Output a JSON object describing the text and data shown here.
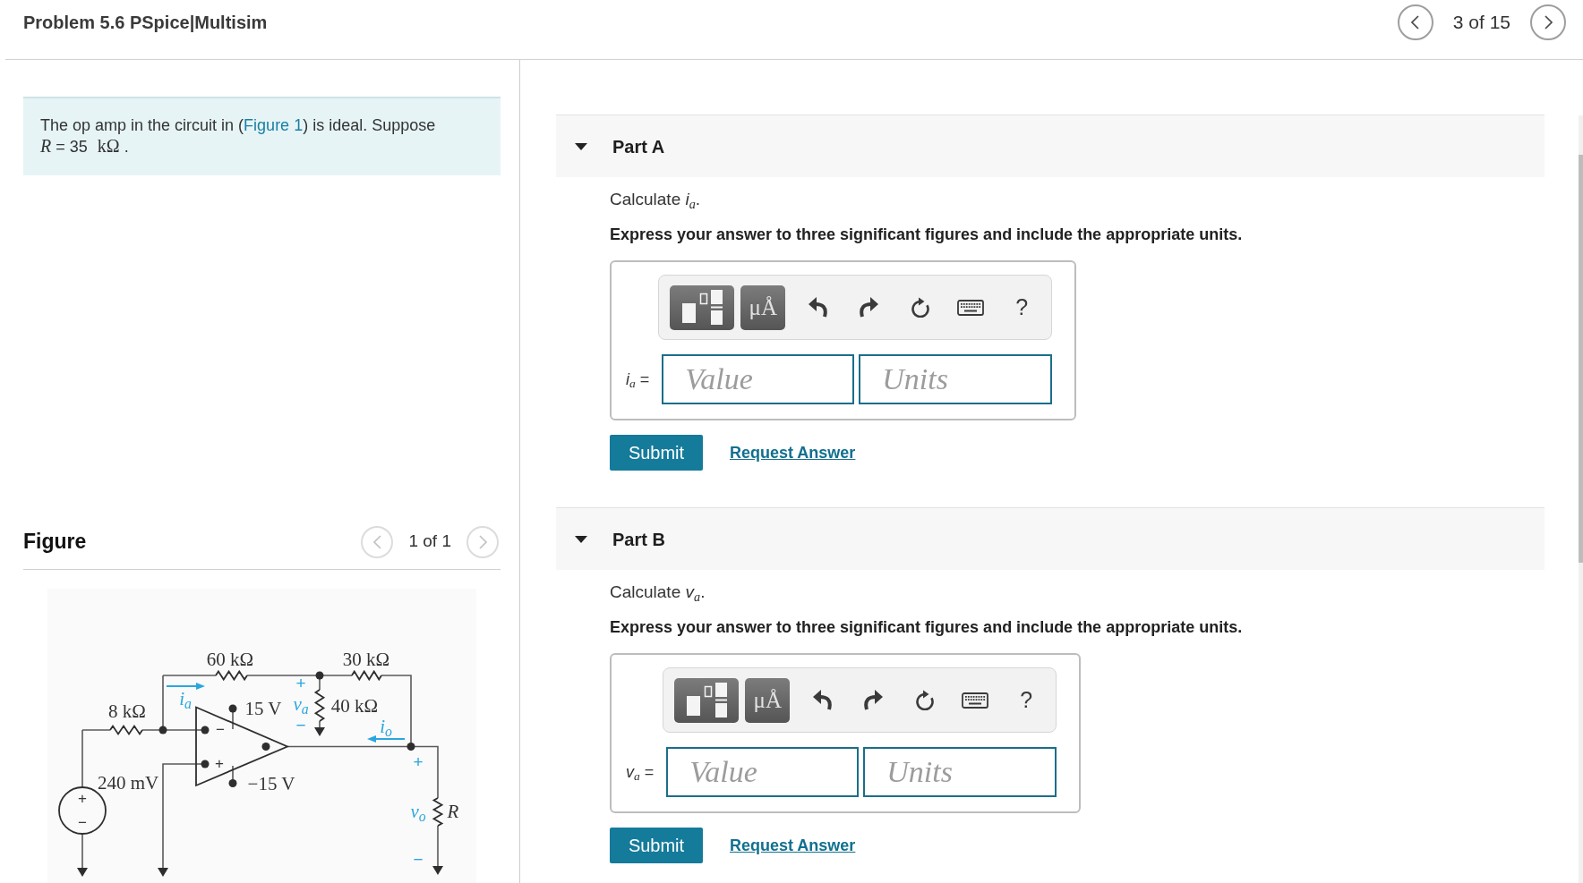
{
  "header": {
    "title": "Problem 5.6 PSpice|Multisim",
    "pager": {
      "position": "3 of 15",
      "prev": {
        "disabled": false
      },
      "next": {
        "disabled": false
      }
    }
  },
  "problem": {
    "text_before": "The op amp in the circuit in (",
    "link": "Figure 1",
    "text_after": ") is ideal. Suppose",
    "equation": {
      "variable": "R",
      "value": "= 35",
      "unit": "kΩ",
      "end": "."
    }
  },
  "figure": {
    "title": "Figure",
    "pager": {
      "position": "1 of 1",
      "prev": {
        "disabled": true
      },
      "next": {
        "disabled": true
      }
    },
    "labels": [
      {
        "kind": "value",
        "text": "60 kΩ"
      },
      {
        "kind": "value",
        "text": "30 kΩ"
      },
      {
        "kind": "sign",
        "text": "+"
      },
      {
        "kind": "quantity",
        "text": "i$_{a}$"
      },
      {
        "kind": "value",
        "text": "15 V"
      },
      {
        "kind": "quantity",
        "text": "v$_{a}$"
      },
      {
        "kind": "value",
        "text": "40 kΩ"
      },
      {
        "kind": "value",
        "text": "8 kΩ"
      },
      {
        "kind": "pin",
        "text": "−"
      },
      {
        "kind": "sign",
        "text": "−"
      },
      {
        "kind": "quantity",
        "text": "i$_{o}$"
      },
      {
        "kind": "pin",
        "text": "+"
      },
      {
        "kind": "sign",
        "text": "+"
      },
      {
        "kind": "value",
        "text": "240 mV"
      },
      {
        "kind": "value",
        "text": "−15 V"
      },
      {
        "kind": "pin",
        "text": "+"
      },
      {
        "kind": "quantity",
        "text": "v$_{o}$"
      },
      {
        "kind": "variable",
        "text": "R"
      },
      {
        "kind": "pin",
        "text": "−"
      },
      {
        "kind": "sign",
        "text": "−"
      }
    ]
  },
  "parts": [
    {
      "title": "Part A",
      "expanded": true,
      "prompt": "Calculate *i*$_{a}$.",
      "instruction": "Express your answer to three significant figures and include the appropriate units.",
      "toolbar": {
        "units_button": "μÅ",
        "help_button": "?"
      },
      "answer_label": "*i*$_{a}$ =",
      "fields": [
        {
          "placeholder": "Value"
        },
        {
          "placeholder": "Units"
        }
      ],
      "submit": "Submit",
      "request": "Request Answer"
    },
    {
      "title": "Part B",
      "expanded": true,
      "prompt": "Calculate *v*$_{a}$.",
      "instruction": "Express your answer to three significant figures and include the appropriate units.",
      "toolbar": {
        "units_button": "μÅ",
        "help_button": "?"
      },
      "answer_label": "*v*$_{a}$ =",
      "fields": [
        {
          "placeholder": "Value"
        },
        {
          "placeholder": "Units"
        }
      ],
      "submit": "Submit",
      "request": "Request Answer"
    }
  ]
}
